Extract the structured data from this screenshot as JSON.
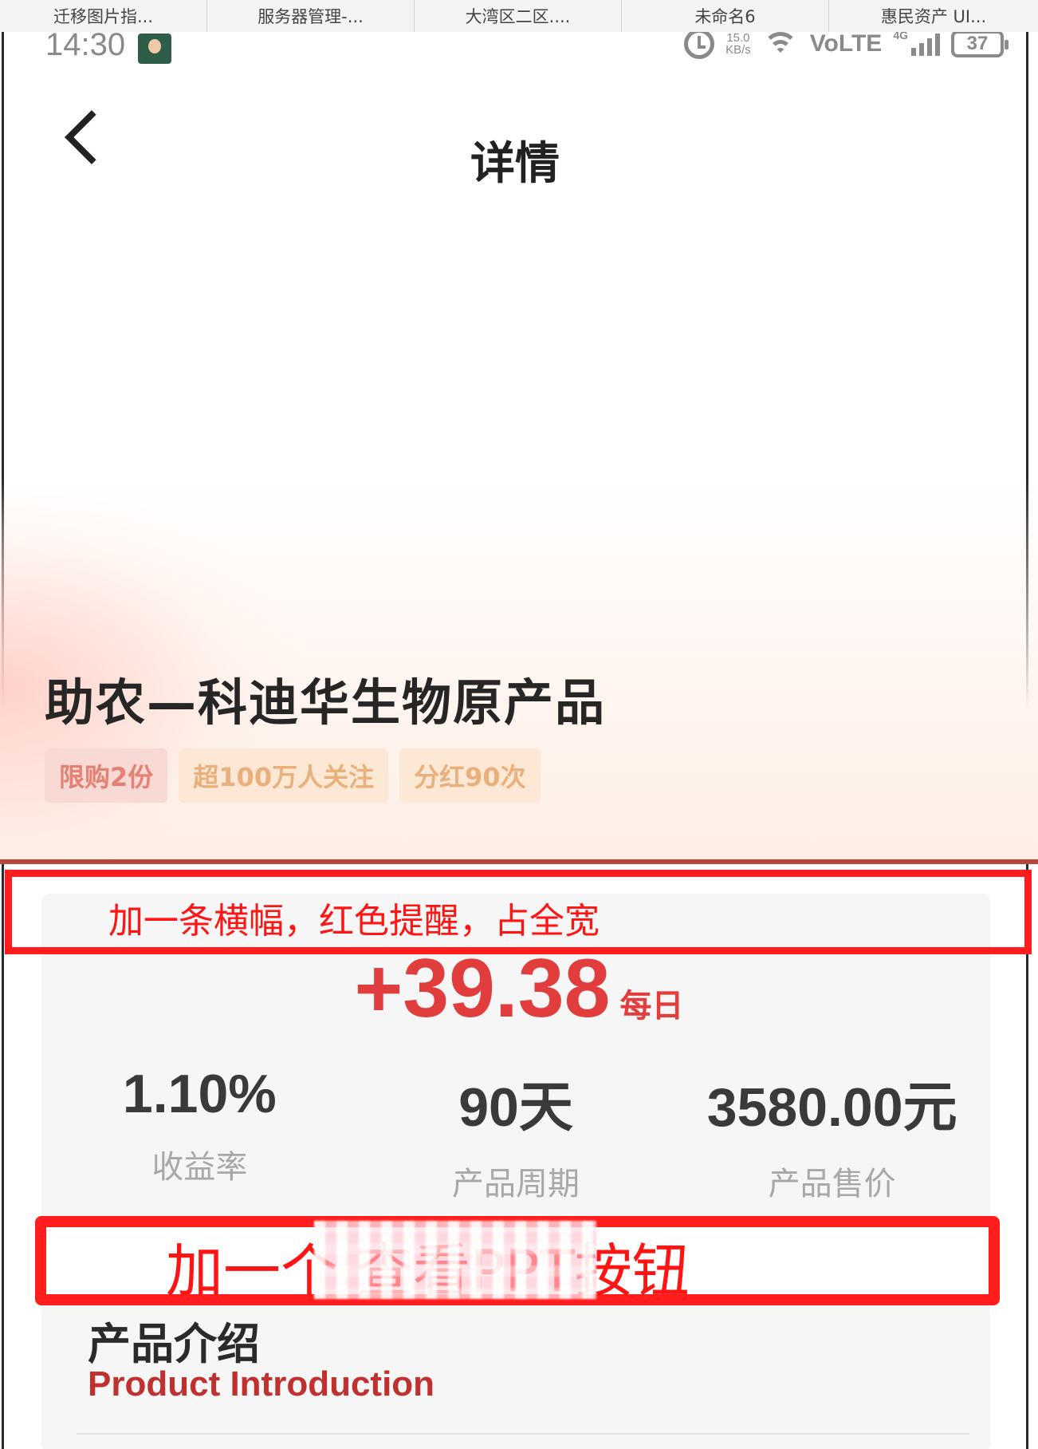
{
  "tabs": [
    "迁移图片指...",
    "服务器管理-...",
    "大湾区二区....",
    "未命名6",
    "惠民资产 UI..."
  ],
  "status_bar": {
    "time": "14:30",
    "speed_value": "15.0",
    "speed_unit": "KB/s",
    "network": "VoLTE",
    "network_type": "4G",
    "battery": "37"
  },
  "header": {
    "title": "详情"
  },
  "product": {
    "title": "助农—科迪华生物原产品",
    "tags": [
      "限购2份",
      "超100万人关注",
      "分红90次"
    ]
  },
  "annotations": {
    "banner_note": "加一条横幅，红色提醒，占全宽",
    "button_note_prefix": "加一个",
    "button_note_main": "查看PPT按钮"
  },
  "earnings": {
    "value": "+39.38",
    "unit": "每日"
  },
  "stats": [
    {
      "value": "1.10%",
      "label": "收益率"
    },
    {
      "value": "90天",
      "label": "产品周期"
    },
    {
      "value": "3580.00元",
      "label": "产品售价"
    }
  ],
  "intro": {
    "title": "产品介绍",
    "subtitle": "Product Introduction"
  },
  "colors": {
    "accent_red": "#e23d3d",
    "annotation_red": "#ff1d1d",
    "intro_red": "#c0302f"
  }
}
